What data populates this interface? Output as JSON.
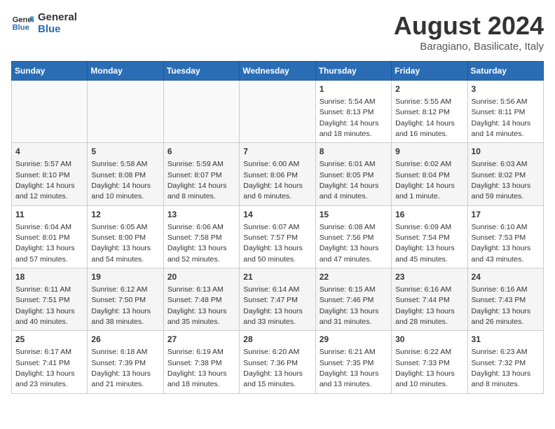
{
  "logo": {
    "line1": "General",
    "line2": "Blue"
  },
  "title": "August 2024",
  "subtitle": "Baragiano, Basilicate, Italy",
  "days_of_week": [
    "Sunday",
    "Monday",
    "Tuesday",
    "Wednesday",
    "Thursday",
    "Friday",
    "Saturday"
  ],
  "weeks": [
    [
      {
        "day": "",
        "info": ""
      },
      {
        "day": "",
        "info": ""
      },
      {
        "day": "",
        "info": ""
      },
      {
        "day": "",
        "info": ""
      },
      {
        "day": "1",
        "info": "Sunrise: 5:54 AM\nSunset: 8:13 PM\nDaylight: 14 hours\nand 18 minutes."
      },
      {
        "day": "2",
        "info": "Sunrise: 5:55 AM\nSunset: 8:12 PM\nDaylight: 14 hours\nand 16 minutes."
      },
      {
        "day": "3",
        "info": "Sunrise: 5:56 AM\nSunset: 8:11 PM\nDaylight: 14 hours\nand 14 minutes."
      }
    ],
    [
      {
        "day": "4",
        "info": "Sunrise: 5:57 AM\nSunset: 8:10 PM\nDaylight: 14 hours\nand 12 minutes."
      },
      {
        "day": "5",
        "info": "Sunrise: 5:58 AM\nSunset: 8:08 PM\nDaylight: 14 hours\nand 10 minutes."
      },
      {
        "day": "6",
        "info": "Sunrise: 5:59 AM\nSunset: 8:07 PM\nDaylight: 14 hours\nand 8 minutes."
      },
      {
        "day": "7",
        "info": "Sunrise: 6:00 AM\nSunset: 8:06 PM\nDaylight: 14 hours\nand 6 minutes."
      },
      {
        "day": "8",
        "info": "Sunrise: 6:01 AM\nSunset: 8:05 PM\nDaylight: 14 hours\nand 4 minutes."
      },
      {
        "day": "9",
        "info": "Sunrise: 6:02 AM\nSunset: 8:04 PM\nDaylight: 14 hours\nand 1 minute."
      },
      {
        "day": "10",
        "info": "Sunrise: 6:03 AM\nSunset: 8:02 PM\nDaylight: 13 hours\nand 59 minutes."
      }
    ],
    [
      {
        "day": "11",
        "info": "Sunrise: 6:04 AM\nSunset: 8:01 PM\nDaylight: 13 hours\nand 57 minutes."
      },
      {
        "day": "12",
        "info": "Sunrise: 6:05 AM\nSunset: 8:00 PM\nDaylight: 13 hours\nand 54 minutes."
      },
      {
        "day": "13",
        "info": "Sunrise: 6:06 AM\nSunset: 7:58 PM\nDaylight: 13 hours\nand 52 minutes."
      },
      {
        "day": "14",
        "info": "Sunrise: 6:07 AM\nSunset: 7:57 PM\nDaylight: 13 hours\nand 50 minutes."
      },
      {
        "day": "15",
        "info": "Sunrise: 6:08 AM\nSunset: 7:56 PM\nDaylight: 13 hours\nand 47 minutes."
      },
      {
        "day": "16",
        "info": "Sunrise: 6:09 AM\nSunset: 7:54 PM\nDaylight: 13 hours\nand 45 minutes."
      },
      {
        "day": "17",
        "info": "Sunrise: 6:10 AM\nSunset: 7:53 PM\nDaylight: 13 hours\nand 43 minutes."
      }
    ],
    [
      {
        "day": "18",
        "info": "Sunrise: 6:11 AM\nSunset: 7:51 PM\nDaylight: 13 hours\nand 40 minutes."
      },
      {
        "day": "19",
        "info": "Sunrise: 6:12 AM\nSunset: 7:50 PM\nDaylight: 13 hours\nand 38 minutes."
      },
      {
        "day": "20",
        "info": "Sunrise: 6:13 AM\nSunset: 7:48 PM\nDaylight: 13 hours\nand 35 minutes."
      },
      {
        "day": "21",
        "info": "Sunrise: 6:14 AM\nSunset: 7:47 PM\nDaylight: 13 hours\nand 33 minutes."
      },
      {
        "day": "22",
        "info": "Sunrise: 6:15 AM\nSunset: 7:46 PM\nDaylight: 13 hours\nand 31 minutes."
      },
      {
        "day": "23",
        "info": "Sunrise: 6:16 AM\nSunset: 7:44 PM\nDaylight: 13 hours\nand 28 minutes."
      },
      {
        "day": "24",
        "info": "Sunrise: 6:16 AM\nSunset: 7:43 PM\nDaylight: 13 hours\nand 26 minutes."
      }
    ],
    [
      {
        "day": "25",
        "info": "Sunrise: 6:17 AM\nSunset: 7:41 PM\nDaylight: 13 hours\nand 23 minutes."
      },
      {
        "day": "26",
        "info": "Sunrise: 6:18 AM\nSunset: 7:39 PM\nDaylight: 13 hours\nand 21 minutes."
      },
      {
        "day": "27",
        "info": "Sunrise: 6:19 AM\nSunset: 7:38 PM\nDaylight: 13 hours\nand 18 minutes."
      },
      {
        "day": "28",
        "info": "Sunrise: 6:20 AM\nSunset: 7:36 PM\nDaylight: 13 hours\nand 15 minutes."
      },
      {
        "day": "29",
        "info": "Sunrise: 6:21 AM\nSunset: 7:35 PM\nDaylight: 13 hours\nand 13 minutes."
      },
      {
        "day": "30",
        "info": "Sunrise: 6:22 AM\nSunset: 7:33 PM\nDaylight: 13 hours\nand 10 minutes."
      },
      {
        "day": "31",
        "info": "Sunrise: 6:23 AM\nSunset: 7:32 PM\nDaylight: 13 hours\nand 8 minutes."
      }
    ]
  ]
}
